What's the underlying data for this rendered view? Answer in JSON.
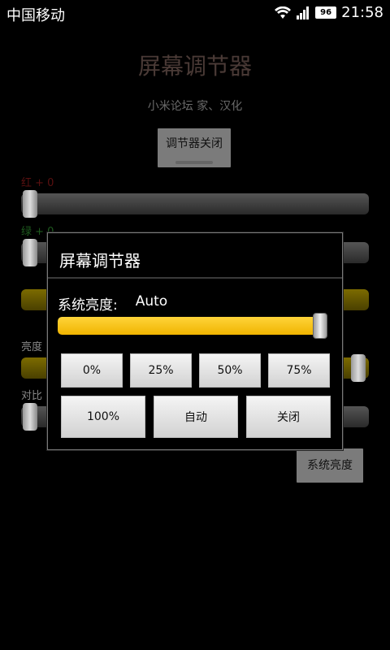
{
  "status_bar": {
    "carrier": "中国移动",
    "battery": "96",
    "time": "21:58",
    "icons": [
      "wifi-icon",
      "signal-icon",
      "battery-icon"
    ]
  },
  "background_app": {
    "title": "屏幕调节器",
    "subtitle": "小米论坛 家、汉化",
    "close_button": "调节器关闭",
    "labels": {
      "red": "红 + 0",
      "green": "绿 + 0",
      "brightness": "亮度",
      "contrast": "对比"
    },
    "system_brightness_button": "系统亮度"
  },
  "dialog": {
    "title": "屏幕调节器",
    "brightness_label": "系统亮度:",
    "brightness_value": "Auto",
    "slider_level": 0.98,
    "preset_buttons": [
      "0%",
      "25%",
      "50%",
      "75%"
    ],
    "action_buttons": [
      "100%",
      "自动",
      "关闭"
    ],
    "colors": {
      "accent": "#f5c000"
    }
  }
}
